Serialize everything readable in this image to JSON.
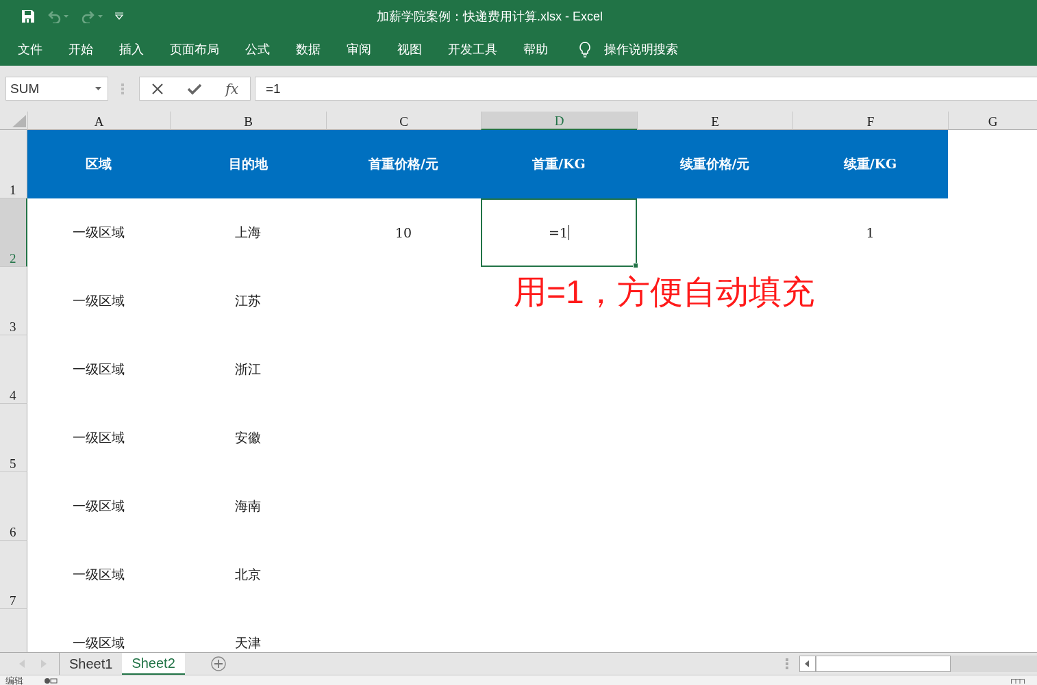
{
  "title_bar": {
    "title": "加薪学院案例：快递费用计算.xlsx  -  Excel"
  },
  "menu": [
    {
      "label": "文件"
    },
    {
      "label": "开始"
    },
    {
      "label": "插入"
    },
    {
      "label": "页面布局"
    },
    {
      "label": "公式"
    },
    {
      "label": "数据"
    },
    {
      "label": "审阅"
    },
    {
      "label": "视图"
    },
    {
      "label": "开发工具"
    },
    {
      "label": "帮助"
    }
  ],
  "tell_me": "操作说明搜索",
  "formula_bar": {
    "name_box": "SUM",
    "insert_function": "fx",
    "formula": "=1"
  },
  "sheet": {
    "columns": [
      {
        "label": "A",
        "selected": false
      },
      {
        "label": "B",
        "selected": false
      },
      {
        "label": "C",
        "selected": false
      },
      {
        "label": "D",
        "selected": true
      },
      {
        "label": "E",
        "selected": false
      },
      {
        "label": "F",
        "selected": false
      },
      {
        "label": "G",
        "selected": false
      }
    ],
    "rows": [
      {
        "number": "1",
        "selected": false,
        "kind": "header",
        "cells": [
          "区域",
          "目的地",
          "首重价格/元",
          "首重/KG",
          "续重价格/元",
          "续重/KG"
        ]
      },
      {
        "number": "2",
        "selected": true,
        "kind": "data",
        "cells": [
          "一级区域",
          "上海",
          "10",
          "=1",
          "",
          "1"
        ]
      },
      {
        "number": "3",
        "selected": false,
        "kind": "data",
        "cells": [
          "一级区域",
          "江苏"
        ]
      },
      {
        "number": "4",
        "selected": false,
        "kind": "data",
        "cells": [
          "一级区域",
          "浙江"
        ]
      },
      {
        "number": "5",
        "selected": false,
        "kind": "data",
        "cells": [
          "一级区域",
          "安徽"
        ]
      },
      {
        "number": "6",
        "selected": false,
        "kind": "data",
        "cells": [
          "一级区域",
          "海南"
        ]
      },
      {
        "number": "7",
        "selected": false,
        "kind": "data",
        "cells": [
          "一级区域",
          "北京"
        ]
      },
      {
        "selected": false,
        "kind": "data",
        "cells": [
          "一级区域",
          "天津"
        ]
      }
    ]
  },
  "annotation": "用=1，方便自动填充",
  "sheet_tabs": [
    {
      "label": "Sheet1",
      "selected": false
    },
    {
      "label": "Sheet2",
      "selected": true
    }
  ],
  "status_bar": {
    "mode": "编辑"
  }
}
